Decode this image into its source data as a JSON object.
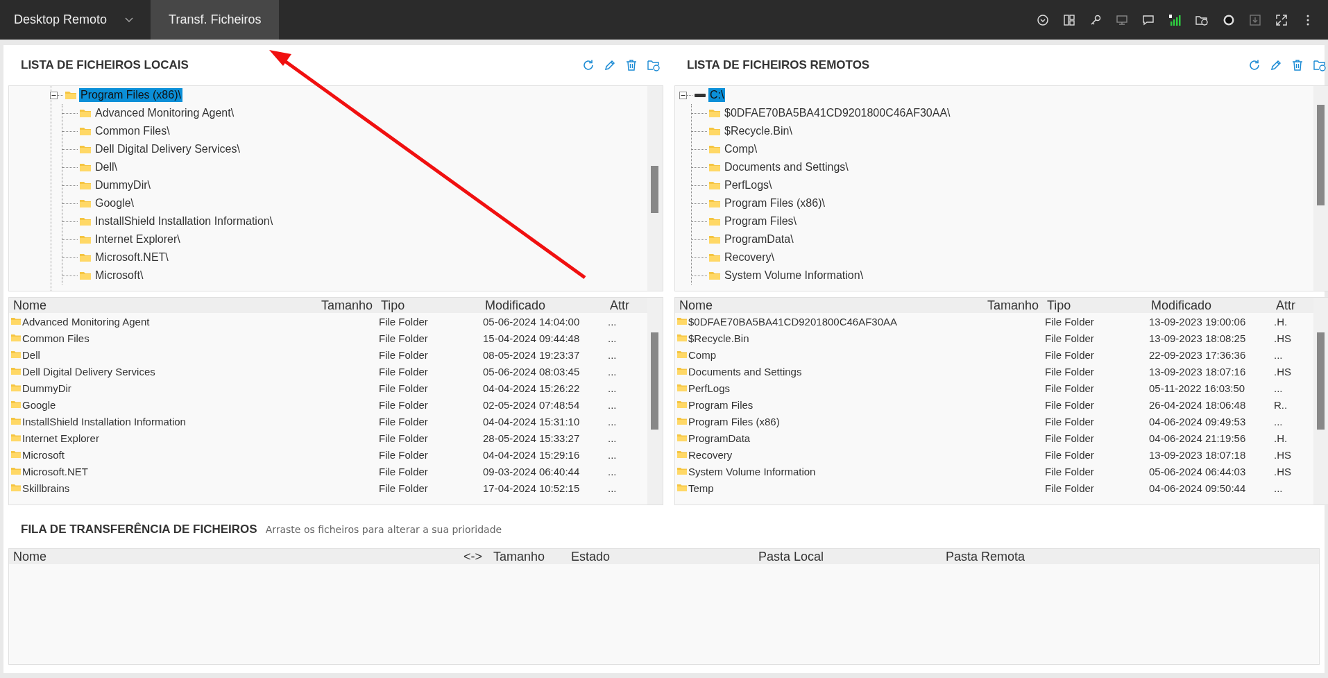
{
  "topbar": {
    "tabs": [
      {
        "label": "Desktop Remoto",
        "selected": false,
        "dropdown": true
      },
      {
        "label": "Transf. Ficheiros",
        "selected": true,
        "dropdown": false
      }
    ]
  },
  "local": {
    "title": "LISTA DE FICHEIROS LOCAIS",
    "tree": [
      {
        "label": "Program Files (x86)\\",
        "kind": "folder",
        "selected": true,
        "expanded": true,
        "children": [
          {
            "label": "Advanced Monitoring Agent\\",
            "kind": "folder",
            "selected": false
          },
          {
            "label": "Common Files\\",
            "kind": "folder",
            "selected": false
          },
          {
            "label": "Dell Digital Delivery Services\\",
            "kind": "folder",
            "selected": false
          },
          {
            "label": "Dell\\",
            "kind": "folder",
            "selected": false
          },
          {
            "label": "DummyDir\\",
            "kind": "folder",
            "selected": false
          },
          {
            "label": "Google\\",
            "kind": "folder",
            "selected": false
          },
          {
            "label": "InstallShield Installation Information\\",
            "kind": "folder",
            "selected": false
          },
          {
            "label": "Internet Explorer\\",
            "kind": "folder",
            "selected": false
          },
          {
            "label": "Microsoft.NET\\",
            "kind": "folder",
            "selected": false
          },
          {
            "label": "Microsoft\\",
            "kind": "folder",
            "selected": false
          }
        ]
      }
    ],
    "columns": [
      "Nome",
      "Tamanho",
      "Tipo",
      "Modificado",
      "Attr"
    ],
    "rows": [
      {
        "name": "Advanced Monitoring Agent",
        "type": "File Folder",
        "modified": "05-06-2024 14:04:00",
        "attr": "..."
      },
      {
        "name": "Common Files",
        "type": "File Folder",
        "modified": "15-04-2024 09:44:48",
        "attr": "..."
      },
      {
        "name": "Dell",
        "type": "File Folder",
        "modified": "08-05-2024 19:23:37",
        "attr": "..."
      },
      {
        "name": "Dell Digital Delivery Services",
        "type": "File Folder",
        "modified": "05-06-2024 08:03:45",
        "attr": "..."
      },
      {
        "name": "DummyDir",
        "type": "File Folder",
        "modified": "04-04-2024 15:26:22",
        "attr": "..."
      },
      {
        "name": "Google",
        "type": "File Folder",
        "modified": "02-05-2024 07:48:54",
        "attr": "..."
      },
      {
        "name": "InstallShield Installation Information",
        "type": "File Folder",
        "modified": "04-04-2024 15:31:10",
        "attr": "..."
      },
      {
        "name": "Internet Explorer",
        "type": "File Folder",
        "modified": "28-05-2024 15:33:27",
        "attr": "..."
      },
      {
        "name": "Microsoft",
        "type": "File Folder",
        "modified": "04-04-2024 15:29:16",
        "attr": "..."
      },
      {
        "name": "Microsoft.NET",
        "type": "File Folder",
        "modified": "09-03-2024 06:40:44",
        "attr": "..."
      },
      {
        "name": "Skillbrains",
        "type": "File Folder",
        "modified": "17-04-2024 10:52:15",
        "attr": "..."
      }
    ]
  },
  "remote": {
    "title": "LISTA DE FICHEIROS REMOTOS",
    "tree": [
      {
        "label": "C:\\",
        "kind": "drive",
        "selected": true,
        "expanded": true,
        "children": [
          {
            "label": "$0DFAE70BA5BA41CD9201800C46AF30AA\\",
            "kind": "folder",
            "selected": false
          },
          {
            "label": "$Recycle.Bin\\",
            "kind": "folder",
            "selected": false
          },
          {
            "label": "Comp\\",
            "kind": "folder",
            "selected": false
          },
          {
            "label": "Documents and Settings\\",
            "kind": "folder",
            "selected": false
          },
          {
            "label": "PerfLogs\\",
            "kind": "folder",
            "selected": false
          },
          {
            "label": "Program Files (x86)\\",
            "kind": "folder",
            "selected": false
          },
          {
            "label": "Program Files\\",
            "kind": "folder",
            "selected": false
          },
          {
            "label": "ProgramData\\",
            "kind": "folder",
            "selected": false
          },
          {
            "label": "Recovery\\",
            "kind": "folder",
            "selected": false
          },
          {
            "label": "System Volume Information\\",
            "kind": "folder",
            "selected": false
          }
        ]
      }
    ],
    "columns": [
      "Nome",
      "Tamanho",
      "Tipo",
      "Modificado",
      "Attr"
    ],
    "rows": [
      {
        "name": "$0DFAE70BA5BA41CD9201800C46AF30AA",
        "type": "File Folder",
        "modified": "13-09-2023 19:00:06",
        "attr": ".H."
      },
      {
        "name": "$Recycle.Bin",
        "type": "File Folder",
        "modified": "13-09-2023 18:08:25",
        "attr": ".HS"
      },
      {
        "name": "Comp",
        "type": "File Folder",
        "modified": "22-09-2023 17:36:36",
        "attr": "..."
      },
      {
        "name": "Documents and Settings",
        "type": "File Folder",
        "modified": "13-09-2023 18:07:16",
        "attr": ".HS"
      },
      {
        "name": "PerfLogs",
        "type": "File Folder",
        "modified": "05-11-2022 16:03:50",
        "attr": "..."
      },
      {
        "name": "Program Files",
        "type": "File Folder",
        "modified": "26-04-2024 18:06:48",
        "attr": "R.."
      },
      {
        "name": "Program Files (x86)",
        "type": "File Folder",
        "modified": "04-06-2024 09:49:53",
        "attr": "..."
      },
      {
        "name": "ProgramData",
        "type": "File Folder",
        "modified": "04-06-2024 21:19:56",
        "attr": ".H."
      },
      {
        "name": "Recovery",
        "type": "File Folder",
        "modified": "13-09-2023 18:07:18",
        "attr": ".HS"
      },
      {
        "name": "System Volume Information",
        "type": "File Folder",
        "modified": "05-06-2024 06:44:03",
        "attr": ".HS"
      },
      {
        "name": "Temp",
        "type": "File Folder",
        "modified": "04-06-2024 09:50:44",
        "attr": "..."
      }
    ]
  },
  "queue": {
    "title": "FILA DE TRANSFERÊNCIA DE FICHEIROS",
    "hint": "Arraste os ficheiros para alterar a sua prioridade",
    "columns": [
      "Nome",
      "<->",
      "Tamanho",
      "Estado",
      "Pasta Local",
      "Pasta Remota"
    ]
  }
}
